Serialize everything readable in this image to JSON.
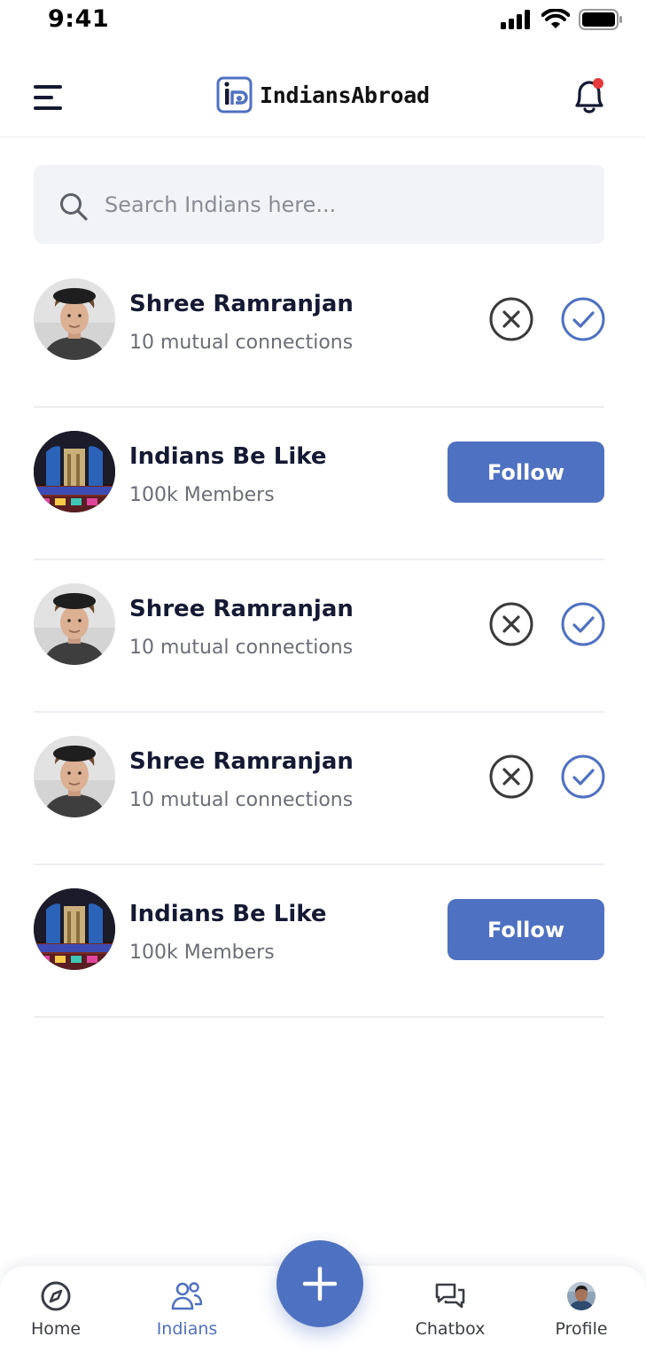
{
  "status_bar": {
    "time": "9:41"
  },
  "header": {
    "app_name": "IndiansAbroad",
    "has_notification": true
  },
  "search": {
    "placeholder": "Search Indians here..."
  },
  "items": [
    {
      "type": "request",
      "name": "Shree Ramranjan",
      "subtitle": "10 mutual connections"
    },
    {
      "type": "group",
      "name": "Indians Be Like",
      "subtitle": "100k Members",
      "action_label": "Follow"
    },
    {
      "type": "request",
      "name": "Shree Ramranjan",
      "subtitle": "10 mutual connections"
    },
    {
      "type": "request",
      "name": "Shree Ramranjan",
      "subtitle": "10 mutual connections"
    },
    {
      "type": "group",
      "name": "Indians Be Like",
      "subtitle": "100k Members",
      "action_label": "Follow"
    }
  ],
  "tabs": [
    {
      "label": "Home",
      "icon": "compass-icon",
      "active": false
    },
    {
      "label": "Indians",
      "icon": "people-icon",
      "active": true
    },
    {
      "label": "Chatbox",
      "icon": "chat-icon",
      "active": false
    },
    {
      "label": "Profile",
      "icon": "avatar",
      "active": false
    }
  ],
  "colors": {
    "accent": "#4f71c1",
    "notification_dot": "#e5393a",
    "text_dark": "#141a33",
    "text_muted": "#6b6e78"
  }
}
